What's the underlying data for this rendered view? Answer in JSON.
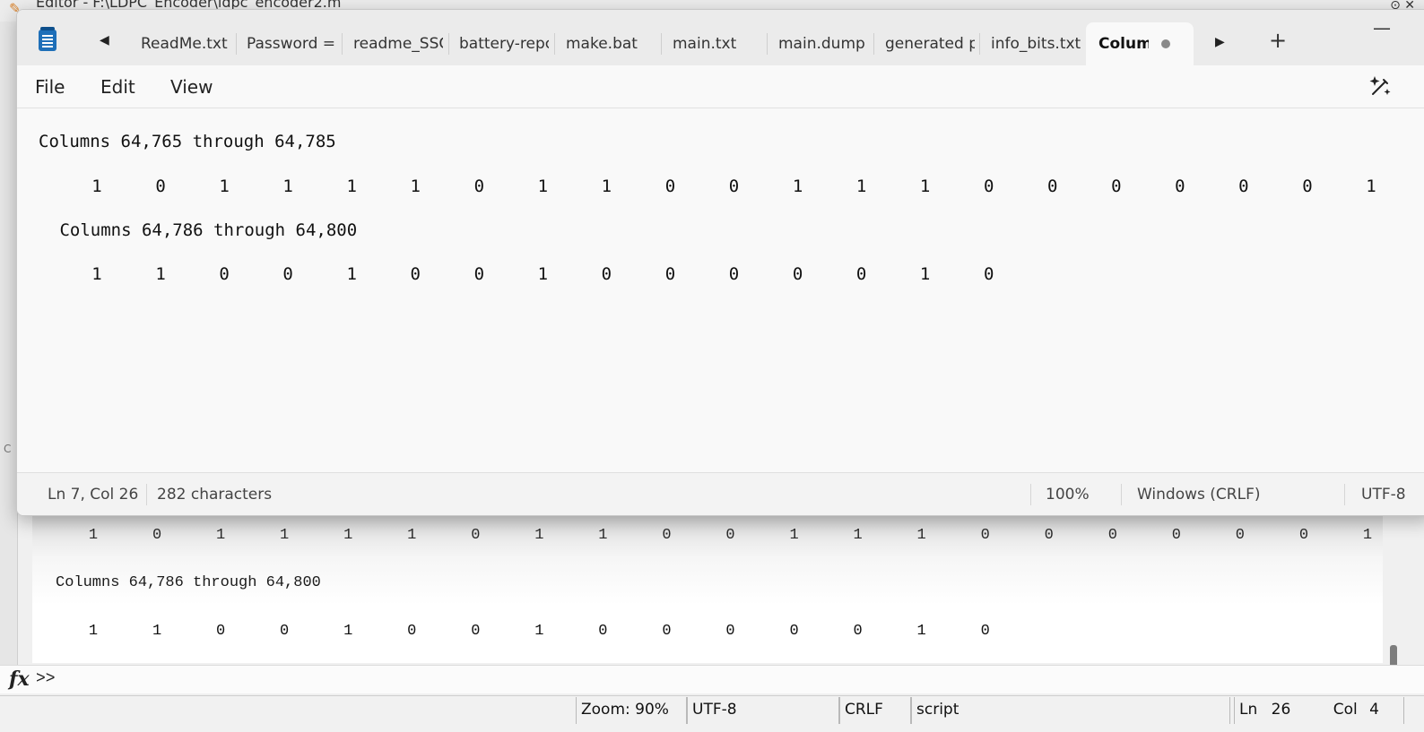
{
  "background": {
    "title": "Editor - F:\\LDPC_Encoder\\ldpc_encoder2.m",
    "left_marker": "C",
    "command_window": {
      "row1_values": [
        "1",
        "0",
        "1",
        "1",
        "1",
        "1",
        "0",
        "1",
        "1",
        "0",
        "0",
        "1",
        "1",
        "1",
        "0",
        "0",
        "0",
        "0",
        "0",
        "0",
        "1"
      ],
      "heading2": "Columns 64,786 through 64,800",
      "row2_values": [
        "1",
        "1",
        "0",
        "0",
        "1",
        "0",
        "0",
        "1",
        "0",
        "0",
        "0",
        "0",
        "0",
        "1",
        "0"
      ]
    },
    "prompt_symbol": "fx",
    "prompt": ">>",
    "statusbar": {
      "zoom": "Zoom: 90%",
      "encoding": "UTF-8",
      "line_ending": "CRLF",
      "type": "script",
      "ln_label": "Ln",
      "ln_value": "26",
      "col_label": "Col",
      "col_value": "4"
    }
  },
  "notepad": {
    "tabs": [
      {
        "label": "ReadMe.txt"
      },
      {
        "label": "Password = '"
      },
      {
        "label": "readme_SSC"
      },
      {
        "label": "battery-repc"
      },
      {
        "label": "make.bat"
      },
      {
        "label": "main.txt"
      },
      {
        "label": "main.dump"
      },
      {
        "label": "generated p"
      },
      {
        "label": "info_bits.txt"
      }
    ],
    "active_tab": "Colum",
    "menu": {
      "file": "File",
      "edit": "Edit",
      "view": "View"
    },
    "content": {
      "heading1": "Columns 64,765 through 64,785",
      "row1_values": [
        "1",
        "0",
        "1",
        "1",
        "1",
        "1",
        "0",
        "1",
        "1",
        "0",
        "0",
        "1",
        "1",
        "1",
        "0",
        "0",
        "0",
        "0",
        "0",
        "0",
        "1"
      ],
      "heading2": " Columns 64,786 through 64,800",
      "row2_values": [
        "1",
        "1",
        "0",
        "0",
        "1",
        "0",
        "0",
        "1",
        "0",
        "0",
        "0",
        "0",
        "0",
        "1",
        "0"
      ]
    },
    "status": {
      "position": "Ln 7, Col 26",
      "characters": "282 characters",
      "zoom": "100%",
      "line_ending": "Windows (CRLF)",
      "encoding": "UTF-8"
    }
  },
  "icons": {
    "app": "notepad-icon",
    "prev": "chevron-left-icon",
    "next": "chevron-right-icon",
    "new_tab": "plus-icon",
    "minimize": "minimize-icon",
    "copilot": "copilot-icon",
    "edit": "pencil-icon"
  }
}
